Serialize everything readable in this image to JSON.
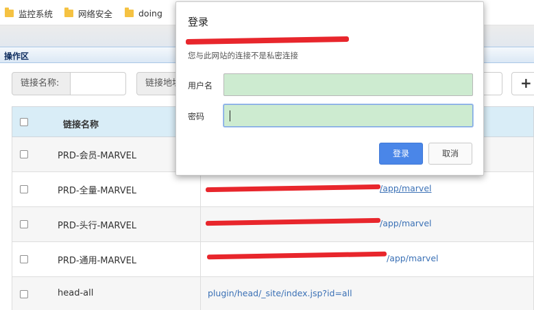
{
  "bookmarks": [
    {
      "label": "监控系统",
      "icon": "folder-icon"
    },
    {
      "label": "网络安全",
      "icon": "folder-icon"
    },
    {
      "label": "doing",
      "icon": "folder-icon"
    }
  ],
  "panel": {
    "title": "操作区"
  },
  "search": {
    "name_label": "链接名称:",
    "url_label": "链接地址:",
    "name_value": "",
    "url_value": ""
  },
  "toolbar": {
    "add_icon": "plus-icon",
    "add_symbol": "+"
  },
  "table": {
    "header_name": "链接名称",
    "rows": [
      {
        "name": "PRD-会员-MARVEL",
        "url": ""
      },
      {
        "name": "PRD-全量-MARVEL",
        "url": "/app/marvel"
      },
      {
        "name": "PRD-头行-MARVEL",
        "url": "/app/marvel"
      },
      {
        "name": "PRD-通用-MARVEL",
        "url": "/app/marvel"
      },
      {
        "name": "head-all",
        "url": "plugin/head/_site/index.jsp?id=all"
      }
    ]
  },
  "dialog": {
    "title": "登录",
    "subtitle": "您与此网站的连接不是私密连接",
    "username_label": "用户名",
    "password_label": "密码",
    "username_value": "",
    "password_value": "",
    "login_label": "登录",
    "cancel_label": "取消"
  },
  "colors": {
    "redaction": "#e8262c",
    "login_button": "#4a86e8",
    "field_autofill": "#cdebd0",
    "table_header": "#d9edf7",
    "link": "#3a70b5"
  }
}
